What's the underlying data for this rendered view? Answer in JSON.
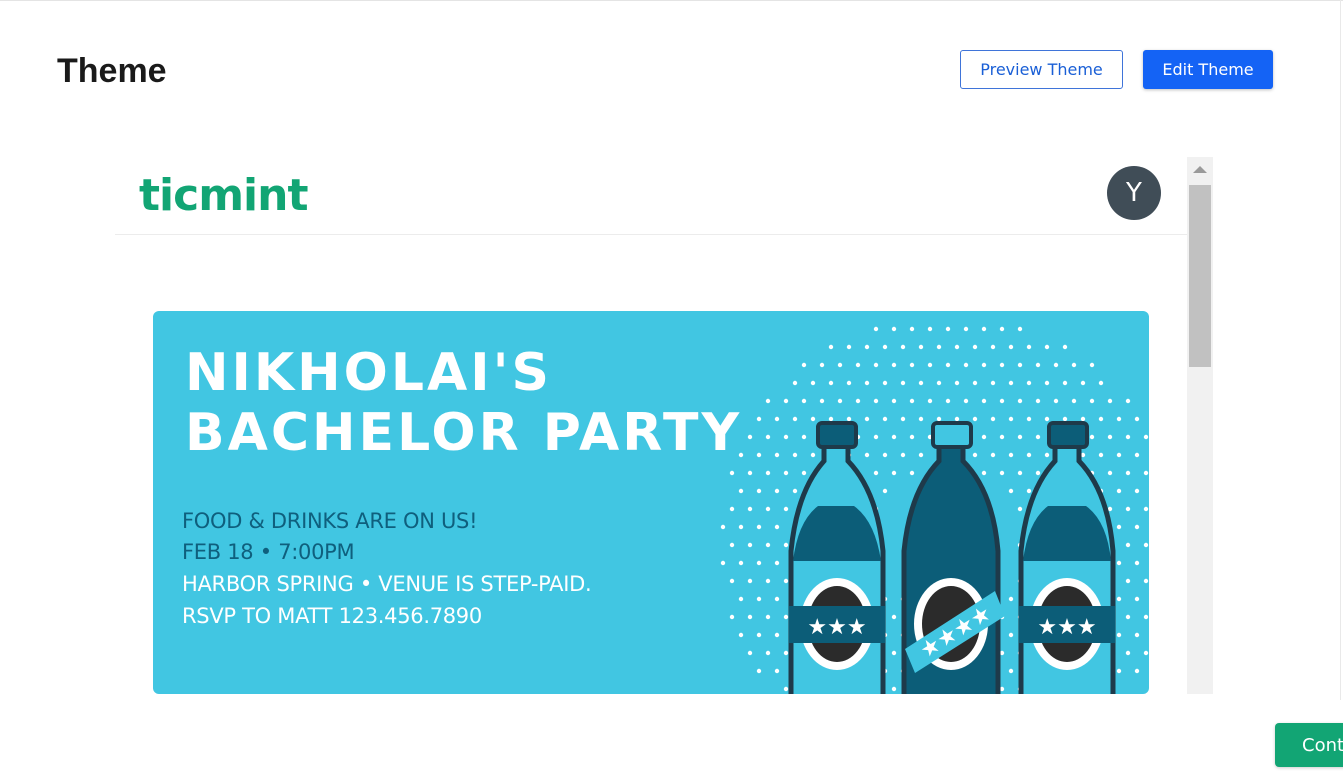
{
  "page": {
    "title": "Theme",
    "preview_button": "Preview Theme",
    "edit_button": "Edit Theme",
    "continue_button": "Cont"
  },
  "preview": {
    "logo": "ticmint",
    "avatar_initial": "Y",
    "banner": {
      "title_line1": "NIKHOLAI'S",
      "title_line2": "BACHELOR PARTY",
      "lines": [
        "FOOD & DRINKS ARE ON US!",
        "FEB 18 • 7:00PM",
        "HARBOR SPRING • VENUE IS STEP-PAID.",
        "RSVP TO MATT 123.456.7890"
      ]
    }
  },
  "colors": {
    "primary_button": "#1463f5",
    "brand_green": "#12a574",
    "banner_bg": "#41c6e2",
    "bottle_dark": "#0c5d78",
    "bottle_outline": "#1e3a4a",
    "avatar_bg": "#404d57"
  },
  "icons": {
    "scroll_up": "scroll-up-arrow-icon"
  }
}
